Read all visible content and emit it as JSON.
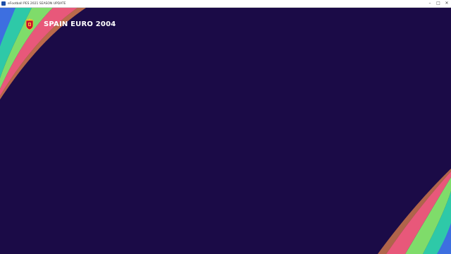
{
  "window": {
    "title": "eFootball PES 2021 SEASON UPDATE",
    "controls": {
      "minimize": "–",
      "maximize": "□",
      "close": "✕"
    }
  },
  "header": {
    "team_name": "SPAIN EURO 2004",
    "crest_icon": "spain-federation-crest-icon"
  },
  "colors": {
    "background": "#1b0b47",
    "swoosh_teal": "#2ec9a8",
    "swoosh_green": "#7fdc6a",
    "swoosh_pink": "#e8587a",
    "swoosh_orange": "#f08a4b",
    "swoosh_blue": "#3d6fe0"
  }
}
